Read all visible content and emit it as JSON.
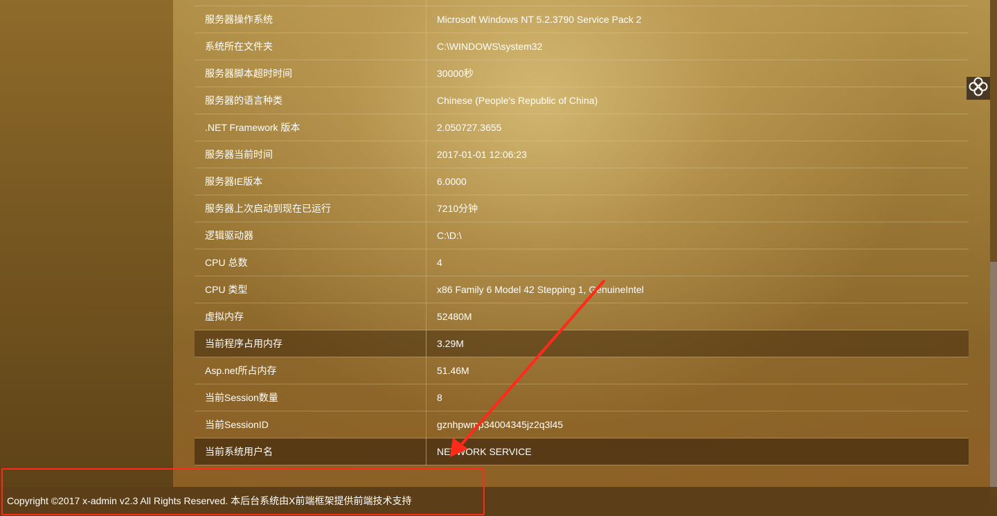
{
  "server_info": {
    "rows": [
      {
        "label": "",
        "value": ""
      },
      {
        "label": "服务器操作系统",
        "value": "Microsoft Windows NT 5.2.3790 Service Pack 2"
      },
      {
        "label": "系统所在文件夹",
        "value": "C:\\WINDOWS\\system32"
      },
      {
        "label": "服务器脚本超时时间",
        "value": "30000秒"
      },
      {
        "label": "服务器的语言种类",
        "value": "Chinese (People's Republic of China)"
      },
      {
        "label": ".NET Framework 版本",
        "value": "2.050727.3655"
      },
      {
        "label": "服务器当前时间",
        "value": "2017-01-01 12:06:23"
      },
      {
        "label": "服务器IE版本",
        "value": "6.0000"
      },
      {
        "label": "服务器上次启动到现在已运行",
        "value": "7210分钟"
      },
      {
        "label": "逻辑驱动器",
        "value": "C:\\D:\\"
      },
      {
        "label": "CPU 总数",
        "value": "4"
      },
      {
        "label": "CPU 类型",
        "value": "x86 Family 6 Model 42 Stepping 1, GenuineIntel"
      },
      {
        "label": "虚拟内存",
        "value": "52480M"
      },
      {
        "label": "当前程序占用内存",
        "value": "3.29M"
      },
      {
        "label": "Asp.net所占内存",
        "value": "51.46M"
      },
      {
        "label": "当前Session数量",
        "value": "8"
      },
      {
        "label": "当前SessionID",
        "value": "gznhpwmp34004345jz2q3l45"
      },
      {
        "label": "当前系统用户名",
        "value": "NETWORK SERVICE"
      }
    ]
  },
  "theme_switcher": {
    "icon": "clover-icon"
  },
  "footer": {
    "copyright": "Copyright ©2017 x-admin v2.3 All Rights Reserved. 本后台系统由X前端框架提供前端技术支持"
  },
  "annotation": {
    "color": "#ff2a1a"
  }
}
